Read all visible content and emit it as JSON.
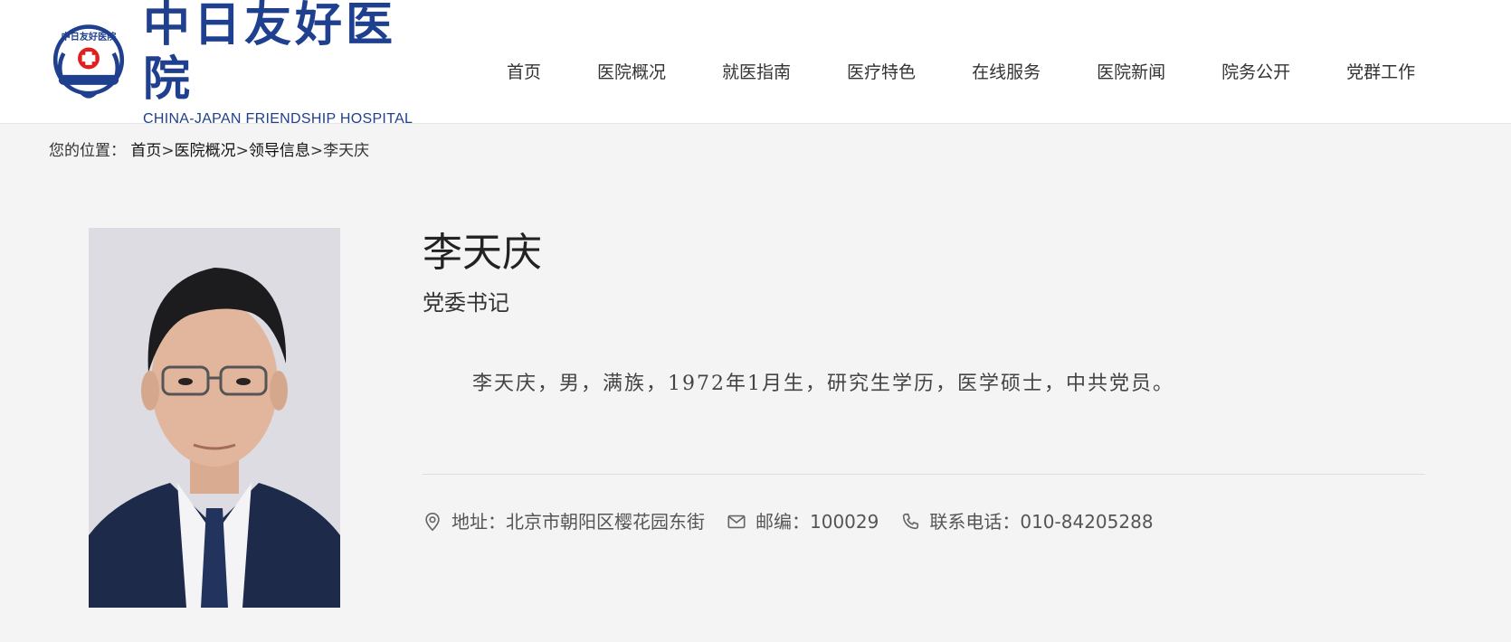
{
  "header": {
    "logo_cn": "中日友好医院",
    "logo_en": "CHINA-JAPAN FRIENDSHIP HOSPITAL",
    "emblem_text": "中日友好医院"
  },
  "nav": {
    "items": [
      {
        "label": "首页"
      },
      {
        "label": "医院概况"
      },
      {
        "label": "就医指南"
      },
      {
        "label": "医疗特色"
      },
      {
        "label": "在线服务"
      },
      {
        "label": "医院新闻"
      },
      {
        "label": "院务公开"
      },
      {
        "label": "党群工作"
      }
    ]
  },
  "breadcrumb": {
    "prefix": "您的位置：",
    "items": [
      "首页",
      "医院概况",
      "领导信息"
    ],
    "separator": ">",
    "current": "李天庆"
  },
  "profile": {
    "name": "李天庆",
    "title": "党委书记",
    "bio": "李天庆，男，满族，1972年1月生，研究生学历，医学硕士，中共党员。"
  },
  "contact": {
    "address": "地址：北京市朝阳区樱花园东街",
    "postcode": "邮编：100029",
    "phone": "联系电话：010-84205288"
  },
  "colors": {
    "brand": "#1f3f8f",
    "emblem_red": "#e02020",
    "background": "#f4f4f4"
  },
  "icons": {
    "address": "location-pin-icon",
    "postcode": "mail-icon",
    "phone": "phone-icon"
  }
}
